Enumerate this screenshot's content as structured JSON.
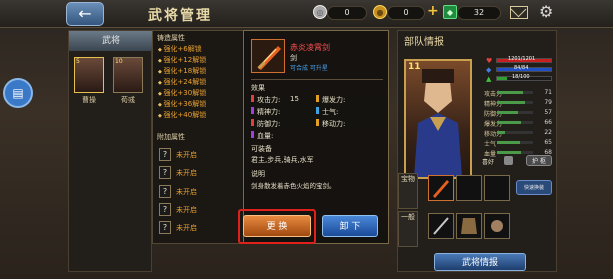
{
  "header": {
    "back_icon": "←",
    "title": "武将管理"
  },
  "resources": [
    {
      "icon": "silver-coin-icon",
      "value": "0",
      "color": "#c0c0c0"
    },
    {
      "icon": "gold-coin-icon",
      "value": "0",
      "color": "#e8b020"
    },
    {
      "icon": "gem-icon",
      "value": "32",
      "color": "#40c060"
    }
  ],
  "leftnav": {
    "tab": "武将",
    "heroes": [
      {
        "name": "曹操",
        "level": "5"
      },
      {
        "name": "荀彧",
        "level": "10"
      }
    ]
  },
  "attr_panel": {
    "forge_title": "铸造属性",
    "forge_items": [
      "强化+6解锁",
      "强化+12解锁",
      "强化+18解锁",
      "强化+24解锁",
      "强化+30解锁",
      "强化+36解锁",
      "强化+40解锁"
    ],
    "extra_title": "附加属性",
    "locked_label": "未开启",
    "locked_count": 6
  },
  "detail": {
    "name": "赤炎凌霄剑",
    "type": "剑",
    "subtext": "可合成 可升星",
    "effect_title": "效果",
    "stats": [
      {
        "label": "攻击力:",
        "value": "15",
        "color": "#e04040"
      },
      {
        "label": "爆发力:",
        "value": "",
        "color": "#e0a020"
      },
      {
        "label": "精神力:",
        "value": "",
        "color": "#a040e0"
      },
      {
        "label": "士气:",
        "value": "",
        "color": "#40a0e0"
      },
      {
        "label": "防御力:",
        "value": "",
        "color": "#e04040"
      },
      {
        "label": "移动力:",
        "value": "",
        "color": "#e0a020"
      },
      {
        "label": "血量:",
        "value": "",
        "color": "#a040e0"
      }
    ],
    "equip_title": "可装备",
    "equip_text": "君主,步兵,骑兵,水军",
    "desc_title": "说明",
    "desc_text": "剑身散发着赤色火焰的宝剑。",
    "change_label": "更 换",
    "unequip_label": "卸 下"
  },
  "right": {
    "title": "部队情报",
    "level": "11",
    "hp": "1201/1201",
    "mp": "84/84",
    "exp": "18/100",
    "exp_fraction": 0.18,
    "stats": [
      {
        "label": "攻击力",
        "value": "71"
      },
      {
        "label": "精神力",
        "value": "79"
      },
      {
        "label": "防御力",
        "value": "57"
      },
      {
        "label": "爆发力",
        "value": "66"
      },
      {
        "label": "移动力",
        "value": "22"
      },
      {
        "label": "士气",
        "value": "65"
      },
      {
        "label": "血量",
        "value": "68"
      }
    ],
    "tag_label": "喜好",
    "skill_btn": "护 枢",
    "treasure_label": "宝物",
    "general_label": "一般",
    "swap_btn": "快速换装",
    "intel_btn": "武将情报"
  }
}
